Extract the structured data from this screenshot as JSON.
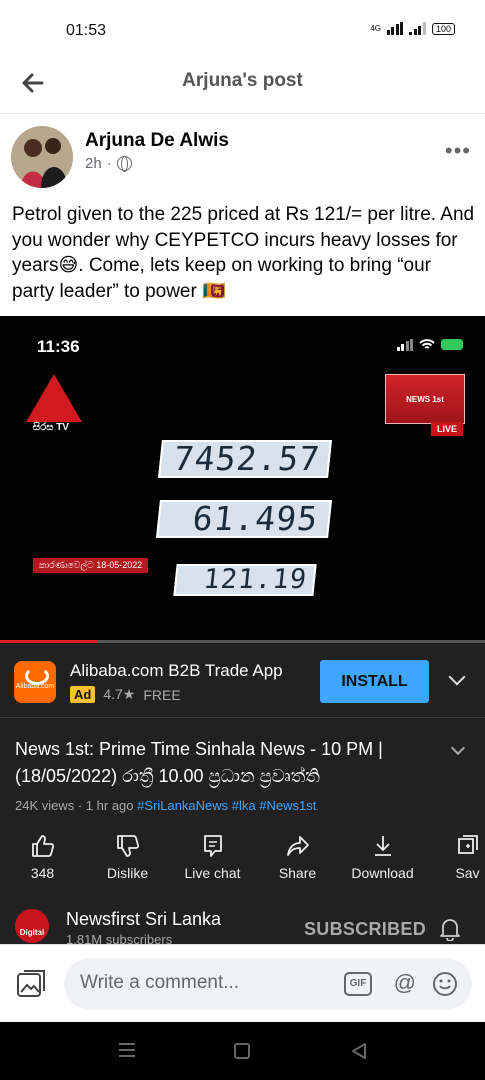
{
  "status_bar": {
    "time": "01:53",
    "network": "4G",
    "battery": "100"
  },
  "header": {
    "title": "Arjuna's post"
  },
  "post": {
    "author": "Arjuna De Alwis",
    "time_ago": "2h",
    "separator": "·",
    "text": "Petrol given to the 225 priced at Rs 121/= per litre. And you wonder why CEYPETCO incurs heavy losses for years😅. Come, lets keep on working to bring “our party leader” to power 🇱🇰"
  },
  "video": {
    "phone_time": "11:36",
    "channel_logo": "සිරස TV",
    "news_logo": "NEWS 1st",
    "live_label": "LIVE",
    "date_tag": "කාරණාවෙල්ට 18-05-2022",
    "pump": {
      "amount": "7452.57",
      "litres": "61.495",
      "price": "121.19"
    },
    "progress_fraction": 0.2
  },
  "ad": {
    "logo_text": "Alibaba.com",
    "title": "Alibaba.com B2B Trade App",
    "badge": "Ad",
    "rating": "4.7★",
    "price": "FREE",
    "install_label": "INSTALL"
  },
  "youtube": {
    "title": "News 1st: Prime Time Sinhala News - 10 PM | (18/05/2022) රාත්‍රී 10.00 ප්‍රධාන ප්‍රවෘත්ති",
    "meta": "24K views · 1 hr ago ",
    "tags": "#SriLankaNews #lka #News1st",
    "actions": [
      {
        "label": "348",
        "icon": "thumbs-up-icon"
      },
      {
        "label": "Dislike",
        "icon": "thumbs-down-icon"
      },
      {
        "label": "Live chat",
        "icon": "chat-icon"
      },
      {
        "label": "Share",
        "icon": "share-icon"
      },
      {
        "label": "Download",
        "icon": "download-icon"
      },
      {
        "label": "Sav",
        "icon": "save-icon"
      }
    ],
    "channel_name": "Newsfirst Sri Lanka",
    "channel_logo_text": "Digital",
    "subscribers": "1.81M subscribers",
    "subscribed_label": "SUBSCRIBED"
  },
  "composer": {
    "placeholder": "Write a comment...",
    "gif_label": "GIF",
    "at_label": "@"
  }
}
